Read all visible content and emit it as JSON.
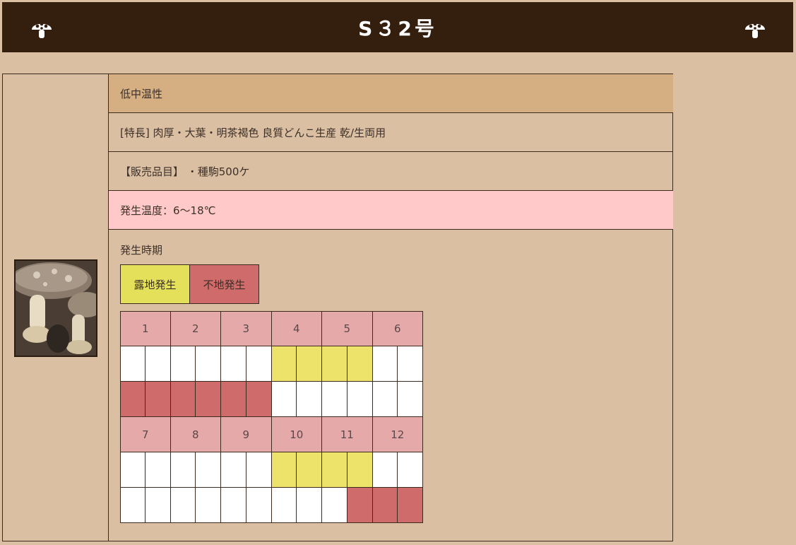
{
  "header": {
    "title": "S３2号",
    "icon": "mushroom-icon"
  },
  "info": {
    "temperature_type": "低中温性",
    "features": "[特長] 肉厚・大葉・明茶褐色 良質どんこ生産 乾/生両用",
    "products": "【販売品目】 ・種駒500ケ",
    "growth_temp": "発生温度：6～18℃"
  },
  "period": {
    "label": "発生時期",
    "legend": {
      "outdoor": "露地発生",
      "indoor": "不地発生"
    }
  },
  "colors": {
    "header_bg": "#341f0f",
    "outdoor": "#ede36a",
    "indoor": "#cf6b6b",
    "month_header": "#e6a9a9",
    "temp_row": "#ffc9c9"
  },
  "calendar": [
    {
      "months": [
        "1",
        "2",
        "3",
        "4",
        "5",
        "6"
      ],
      "outdoor": [
        0,
        0,
        0,
        0,
        0,
        0,
        1,
        1,
        1,
        1,
        0,
        0
      ],
      "indoor": [
        1,
        1,
        1,
        1,
        1,
        1,
        0,
        0,
        0,
        0,
        0,
        0
      ]
    },
    {
      "months": [
        "7",
        "8",
        "9",
        "10",
        "11",
        "12"
      ],
      "outdoor": [
        0,
        0,
        0,
        0,
        0,
        0,
        1,
        1,
        1,
        1,
        0,
        0
      ],
      "indoor": [
        0,
        0,
        0,
        0,
        0,
        0,
        0,
        0,
        0,
        1,
        1,
        1
      ]
    }
  ]
}
